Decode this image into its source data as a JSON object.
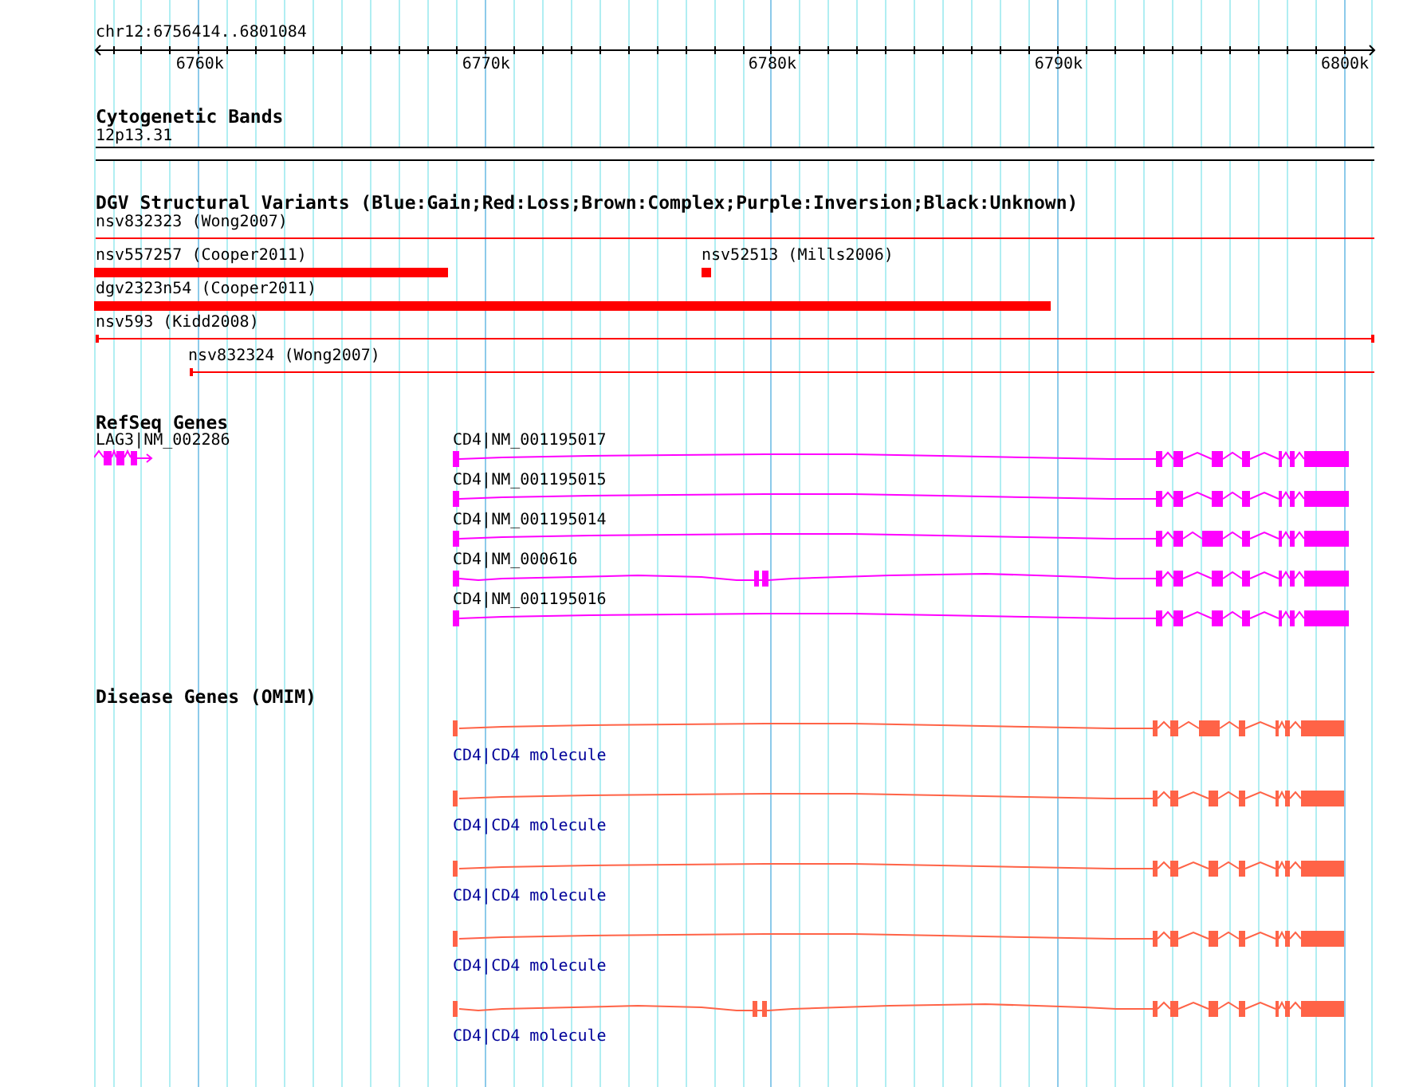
{
  "ruler": {
    "range": "chr12:6756414..6801084",
    "ticks": [
      "6760k",
      "6770k",
      "6780k",
      "6790k",
      "6800k"
    ]
  },
  "tracks": [
    {
      "kind": "bands",
      "title": "Cytogenetic Bands",
      "features": [
        {
          "label": "12p13.31"
        }
      ]
    },
    {
      "kind": "variants",
      "title": "DGV Structural Variants (Blue:Gain;Red:Loss;Brown:Complex;Purple:Inversion;Black:Unknown)",
      "rows": [
        {
          "features": [
            {
              "label": "nsv832323 (Wong2007)",
              "kind": "line"
            }
          ]
        },
        {
          "features": [
            {
              "label": "nsv557257 (Cooper2011)",
              "kind": "bar"
            },
            {
              "label": "nsv52513 (Mills2006)",
              "kind": "bar"
            }
          ]
        },
        {
          "features": [
            {
              "label": "dgv2323n54 (Cooper2011)",
              "kind": "bar"
            }
          ]
        },
        {
          "features": [
            {
              "label": "nsv593 (Kidd2008)",
              "kind": "line"
            }
          ]
        },
        {
          "features": [
            {
              "label": "nsv832324 (Wong2007)",
              "kind": "line"
            }
          ]
        }
      ]
    },
    {
      "kind": "genes",
      "title": "RefSeq Genes",
      "features": [
        {
          "label": "LAG3|NM_002286"
        },
        {
          "label": "CD4|NM_001195017"
        },
        {
          "label": "CD4|NM_001195015"
        },
        {
          "label": "CD4|NM_001195014"
        },
        {
          "label": "CD4|NM_000616"
        },
        {
          "label": "CD4|NM_001195016"
        }
      ]
    },
    {
      "kind": "disease",
      "title": "Disease Genes (OMIM)",
      "features": [
        {
          "label": "CD4|CD4 molecule"
        },
        {
          "label": "CD4|CD4 molecule"
        },
        {
          "label": "CD4|CD4 molecule"
        },
        {
          "label": "CD4|CD4 molecule"
        },
        {
          "label": "CD4|CD4 molecule"
        }
      ]
    }
  ]
}
